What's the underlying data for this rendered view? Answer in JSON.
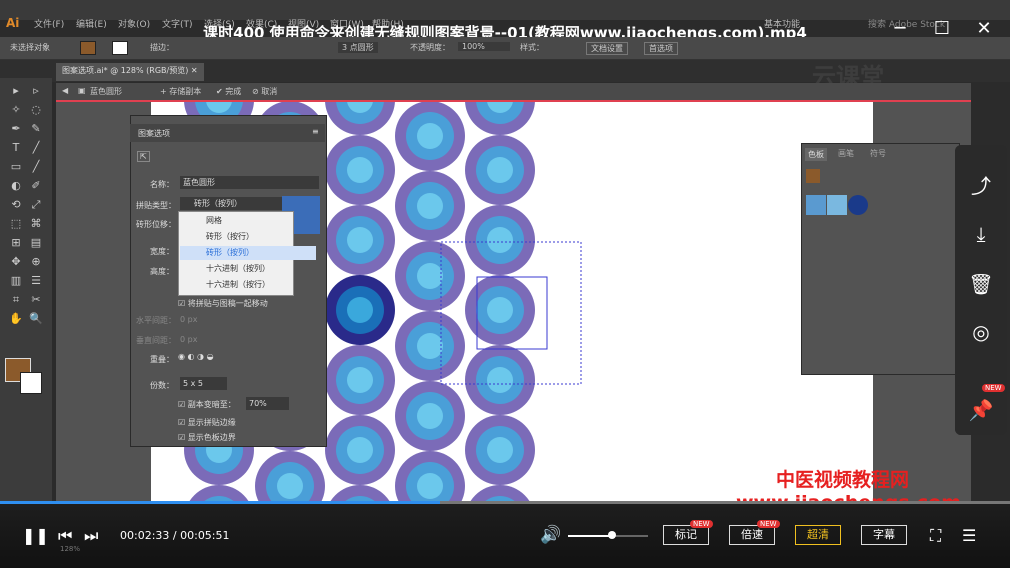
{
  "window": {
    "title": "课时400 使用命令来创建无缝规则图案背景--01(教程网www.jiaochengs.com).mp4",
    "app_logo": "Ai"
  },
  "menus": [
    "文件(F)",
    "编辑(E)",
    "对象(O)",
    "文字(T)",
    "选择(S)",
    "效果(C)",
    "视图(V)",
    "窗口(W)",
    "帮助(H)"
  ],
  "workspace": "基本功能",
  "search_placeholder": "搜索 Adobe Stock",
  "control_bar": {
    "no_selection": "未选择对象",
    "stroke_label": "描边：",
    "brush": "3 点圆形",
    "opacity_label": "不透明度：",
    "opacity": "100%",
    "style_label": "样式：",
    "doc_setup": "文档设置",
    "preferences": "首选项"
  },
  "document_tab": "图案选项.ai* @ 128% (RGB/预览)",
  "pattern_bar": {
    "name": "蓝色圆形",
    "save_copy": "存储副本",
    "done": "完成",
    "cancel": "取消"
  },
  "pattern_panel": {
    "title": "图案选项",
    "name_label": "名称：",
    "name_value": "蓝色圆形",
    "tile_type_label": "拼贴类型：",
    "tile_type_value": "砖形（按列）",
    "brick_offset_label": "砖形位移：",
    "tile_options": [
      "网格",
      "砖形（按行）",
      "砖形（按列）",
      "十六进制（按列）",
      "十六进制（按行）"
    ],
    "selected_option_index": 2,
    "width_label": "宽度：",
    "height_label": "高度：",
    "move_tile": "将拼贴与图稿一起移动",
    "h_spacing_label": "水平间距：",
    "h_spacing_value": "0 px",
    "v_spacing_label": "垂直间距：",
    "v_spacing_value": "0 px",
    "overlap_label": "重叠：",
    "copies_label": "份数：",
    "copies_value": "5 x 5",
    "dim_copies": "副本变暗至：",
    "dim_value": "70%",
    "show_tile_edge": "显示拼贴边缘",
    "show_swatch_bounds": "显示色板边界"
  },
  "swatches_panel": {
    "tabs": [
      "色板",
      "画笔",
      "符号"
    ],
    "active_tab": 0
  },
  "watermark": {
    "cn": "中医视频教程网",
    "url": "www.jiaochengs.com",
    "brand": "云课堂"
  },
  "player": {
    "current_time": "00:02:33",
    "duration": "00:05:51",
    "progress": 0.436,
    "volume": 0.55,
    "mark_label": "标记",
    "speed_label": "倍速",
    "quality_label": "超清",
    "subtitle_label": "字幕",
    "new_badge": "NEW",
    "status_zoom": "128%"
  },
  "colors": {
    "outer_circle": "#7b6bb8",
    "mid_circle": "#4a9fd8",
    "inner_circle": "#6bc8ec",
    "selected_outer": "#2a2a8a",
    "selected_mid": "#1a6fb8",
    "selected_inner": "#3aa8dc",
    "accent_blue": "#2f8ff0",
    "watermark_red": "#e62020"
  }
}
